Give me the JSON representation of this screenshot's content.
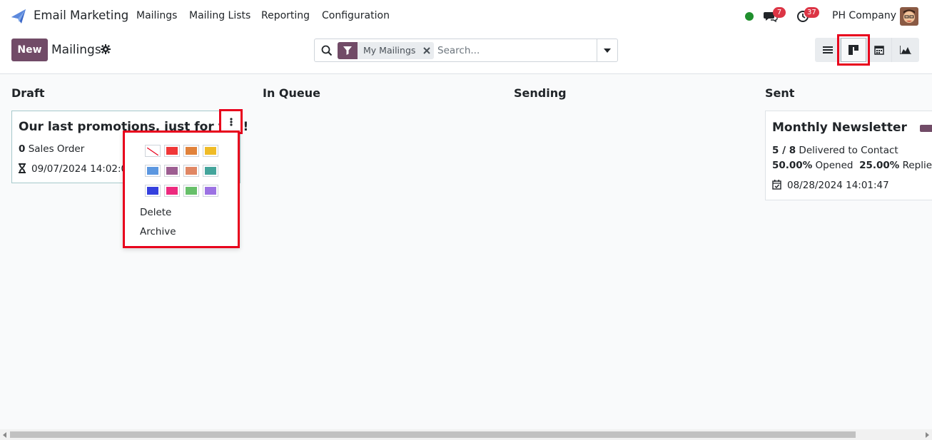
{
  "app": {
    "name": "Email Marketing",
    "menus": [
      "Mailings",
      "Mailing Lists",
      "Reporting",
      "Configuration"
    ],
    "messages_count": "7",
    "activities_count": "37",
    "company": "PH Company"
  },
  "control_panel": {
    "new_label": "New",
    "title": "Mailings",
    "facet_label": "My Mailings",
    "search_placeholder": "Search..."
  },
  "kanban": {
    "columns": [
      "Draft",
      "In Queue",
      "Sending",
      "Sent"
    ],
    "draft_card": {
      "title": "Our last promotions, just for you!",
      "count": "0",
      "count_label": "Sales Order",
      "datetime": "09/07/2024 14:02:00"
    },
    "sent_card": {
      "title": "Monthly Newsletter",
      "delivered": "5 / 8",
      "delivered_label": "Delivered to Contact",
      "opened": "50.00%",
      "opened_label": "Opened",
      "replied": "25.00%",
      "replied_label": "Replied",
      "datetime": "08/28/2024 14:01:47"
    },
    "dropdown": {
      "colors": [
        "none",
        "#f03738",
        "#e1823b",
        "#efbb27",
        "#5c97e0",
        "#9d5e91",
        "#e08764",
        "#44a59c",
        "#3440de",
        "#ed2a7e",
        "#67c06a",
        "#9c72e3"
      ],
      "delete_label": "Delete",
      "archive_label": "Archive"
    }
  },
  "colors": {
    "brand": "#714b67",
    "highlight": "#e8001c",
    "online": "#1f8f2d",
    "badge": "#dc3545"
  }
}
